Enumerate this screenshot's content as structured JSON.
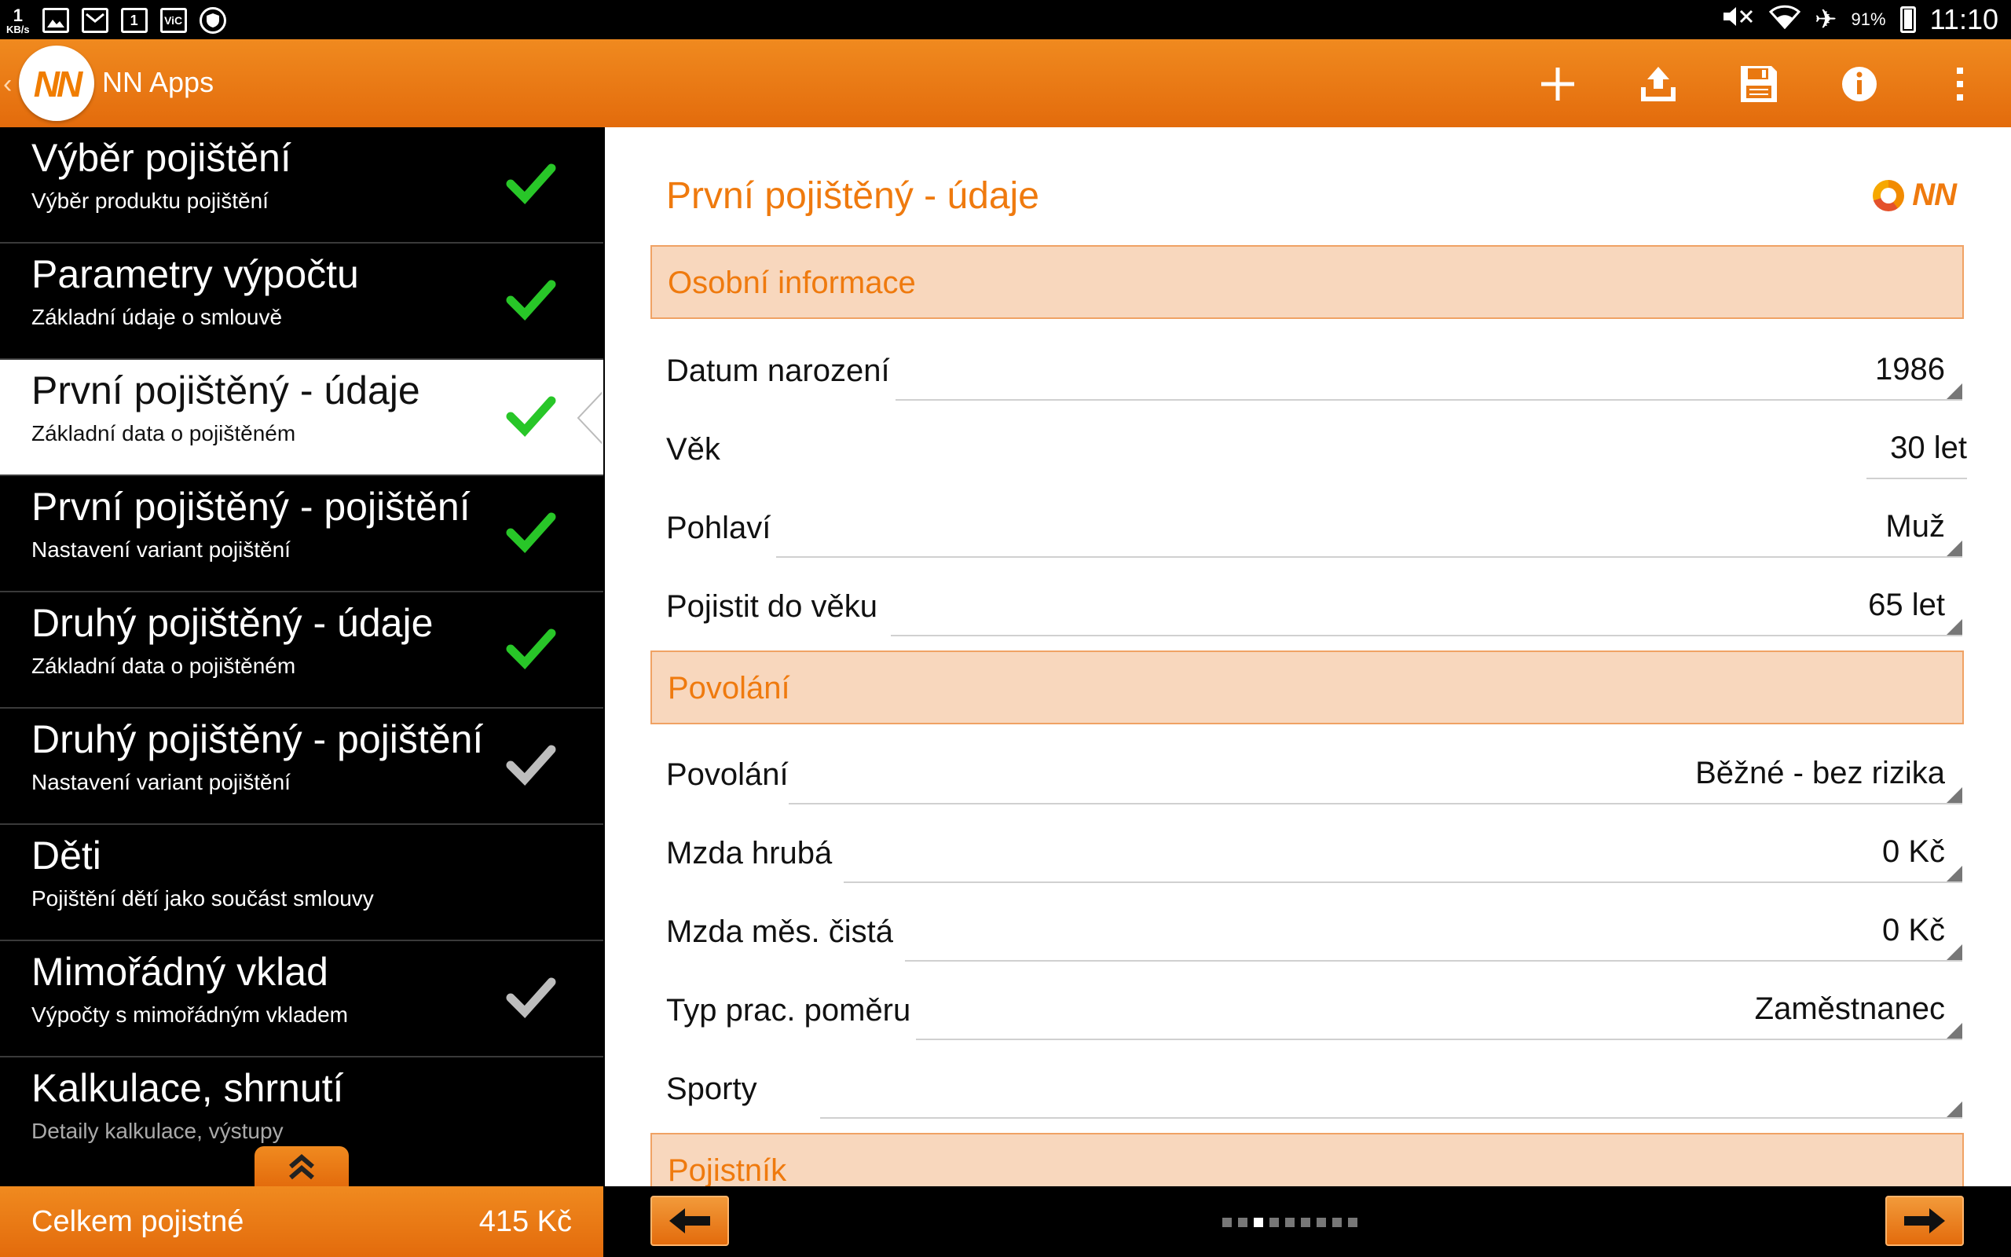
{
  "status_bar": {
    "kbs_value": "1",
    "kbs_unit": "KB/s",
    "calendar_day": "1",
    "vic_label": "ViC",
    "battery_percent": "91%",
    "time": "11:10",
    "battery_level": 0.91
  },
  "action_bar": {
    "back_glyph": "‹",
    "logo_text": "NN",
    "title": "NN Apps",
    "actions": [
      "add-icon",
      "upload-icon",
      "save-icon",
      "info-icon",
      "overflow-menu-icon"
    ]
  },
  "sidebar": {
    "steps": [
      {
        "title": "Výběr pojištění",
        "subtitle": "Výběr produktu pojištění",
        "check": "green"
      },
      {
        "title": "Parametry výpočtu",
        "subtitle": "Základní údaje o smlouvě",
        "check": "green"
      },
      {
        "title": "První pojištěný - údaje",
        "subtitle": "Základní data o pojištěném",
        "check": "green",
        "active": true
      },
      {
        "title": "První pojištěný - pojištění",
        "subtitle": "Nastavení variant pojištění",
        "check": "green"
      },
      {
        "title": "Druhý pojištěný - údaje",
        "subtitle": "Základní data o pojištěném",
        "check": "green"
      },
      {
        "title": "Druhý pojištěný - pojištění",
        "subtitle": "Nastavení variant pojištění",
        "check": "gray"
      },
      {
        "title": "Děti",
        "subtitle": "Pojištění dětí jako součást smlouvy",
        "check": "none"
      },
      {
        "title": "Mimořádný vklad",
        "subtitle": "Výpočty s mimořádným vkladem",
        "check": "gray"
      },
      {
        "title": "Kalkulace, shrnutí",
        "subtitle": "Detaily kalkulace, výstupy",
        "check": "none"
      }
    ],
    "total_label": "Celkem pojistné",
    "total_value": "415 Kč"
  },
  "main": {
    "title": "První pojištěný - údaje",
    "brand_text": "NN",
    "sections": {
      "personal": "Osobní informace",
      "occupation": "Povolání",
      "policyholder": "Pojistník"
    },
    "fields": [
      {
        "label": "Datum narození",
        "value": "1986",
        "dropdown": true
      },
      {
        "label": "Věk",
        "value": "30 let",
        "dropdown": false
      },
      {
        "label": "Pohlaví",
        "value": "Muž",
        "dropdown": true
      },
      {
        "label": "Pojistit do věku",
        "value": "65 let",
        "dropdown": true
      },
      {
        "label": "Povolání",
        "value": "Běžné - bez rizika",
        "dropdown": true
      },
      {
        "label": "Mzda hrubá",
        "value": "0 Kč",
        "dropdown": true
      },
      {
        "label": "Mzda měs. čistá",
        "value": "0 Kč",
        "dropdown": true
      },
      {
        "label": "Typ prac. poměru",
        "value": "Zaměstnanec",
        "dropdown": true
      },
      {
        "label": "Sporty",
        "value": "",
        "dropdown": true
      }
    ]
  },
  "pager": {
    "total_pages": 9,
    "current_page": 3
  },
  "colors": {
    "accent": "#ef7a0e",
    "action_bar": "#e97811",
    "section_bg": "#f8d7bd",
    "check_green": "#2ecc2e",
    "check_gray": "#bdbdbd"
  }
}
